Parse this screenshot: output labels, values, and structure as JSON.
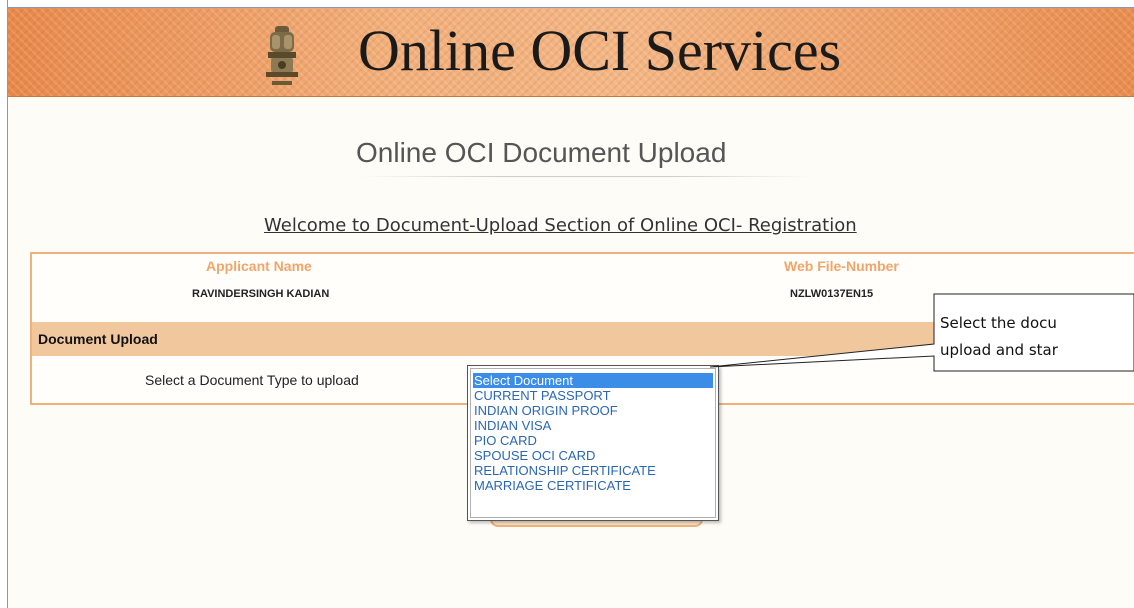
{
  "header": {
    "site_title": "Online OCI Services",
    "emblem_icon": "national-emblem-icon"
  },
  "page": {
    "heading": "Online OCI Document Upload",
    "welcome": "Welcome to Document-Upload Section of Online OCI- Registration"
  },
  "applicant": {
    "name_label": "Applicant Name",
    "name_value": "RAVINDERSINGH KADIAN",
    "file_label": "Web File-Number",
    "file_value": "NZLW0137EN15"
  },
  "upload": {
    "section_title": "Document Upload",
    "prompt": "Select a Document Type to upload",
    "options": [
      "Select Document",
      "CURRENT PASSPORT",
      "INDIAN ORIGIN PROOF",
      "INDIAN VISA",
      "PIO CARD",
      "SPOUSE OCI CARD",
      "RELATIONSHIP CERTIFICATE",
      "MARRIAGE CERTIFICATE"
    ],
    "selected_option": "Select Document"
  },
  "callout": {
    "line1": "Select the docu",
    "line2": "upload and star"
  },
  "colors": {
    "header_orange": "#ee9a5c",
    "label_orange": "#f0a56a",
    "section_bar": "#f1c89e",
    "selected_blue": "#3b8de8",
    "option_blue": "#2a67b5"
  }
}
